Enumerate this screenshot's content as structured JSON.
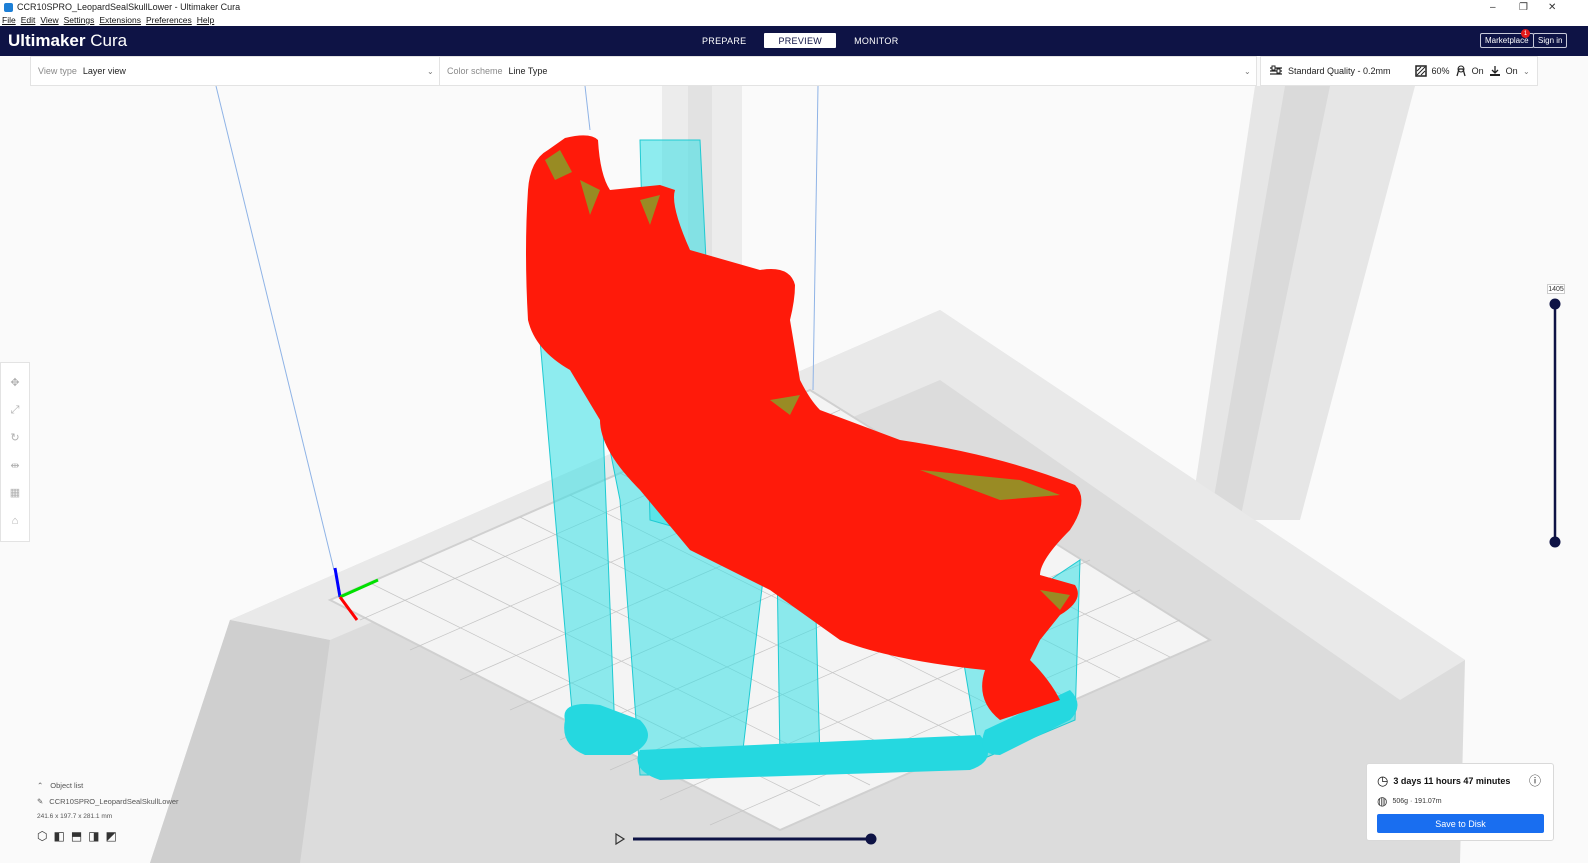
{
  "window": {
    "title": "CCR10SPRO_LeopardSealSkullLower - Ultimaker Cura",
    "controls": [
      "–",
      "❐",
      "✕"
    ]
  },
  "menu": [
    "File",
    "Edit",
    "View",
    "Settings",
    "Extensions",
    "Preferences",
    "Help"
  ],
  "header": {
    "logo_bold": "Ultimaker",
    "logo_light": " Cura",
    "tabs": [
      {
        "label": "PREPARE",
        "active": false
      },
      {
        "label": "PREVIEW",
        "active": true
      },
      {
        "label": "MONITOR",
        "active": false
      }
    ],
    "marketplace": "Marketplace",
    "marketplace_badge": "1",
    "signin": "Sign in"
  },
  "toolbar": {
    "view_type_label": "View type",
    "view_type_value": "Layer view",
    "color_scheme_label": "Color scheme",
    "color_scheme_value": "Line Type",
    "quality": "Standard Quality - 0.2mm",
    "infill": "60%",
    "support": "On",
    "adhesion": "On"
  },
  "layer_slider": {
    "max_label": "1405"
  },
  "object": {
    "list_label": "Object list",
    "name": "CCR10SPRO_LeopardSealSkullLower",
    "dimensions": "241.6 x 197.7 x 281.1 mm"
  },
  "print_panel": {
    "time": "3 days 11 hours 47 minutes",
    "material": "506g · 191.07m",
    "save_label": "Save to Disk"
  },
  "colors": {
    "header": "#0e1345",
    "accent": "#196ef0",
    "model": "#ff1a0a",
    "support": "#35e0e6"
  }
}
